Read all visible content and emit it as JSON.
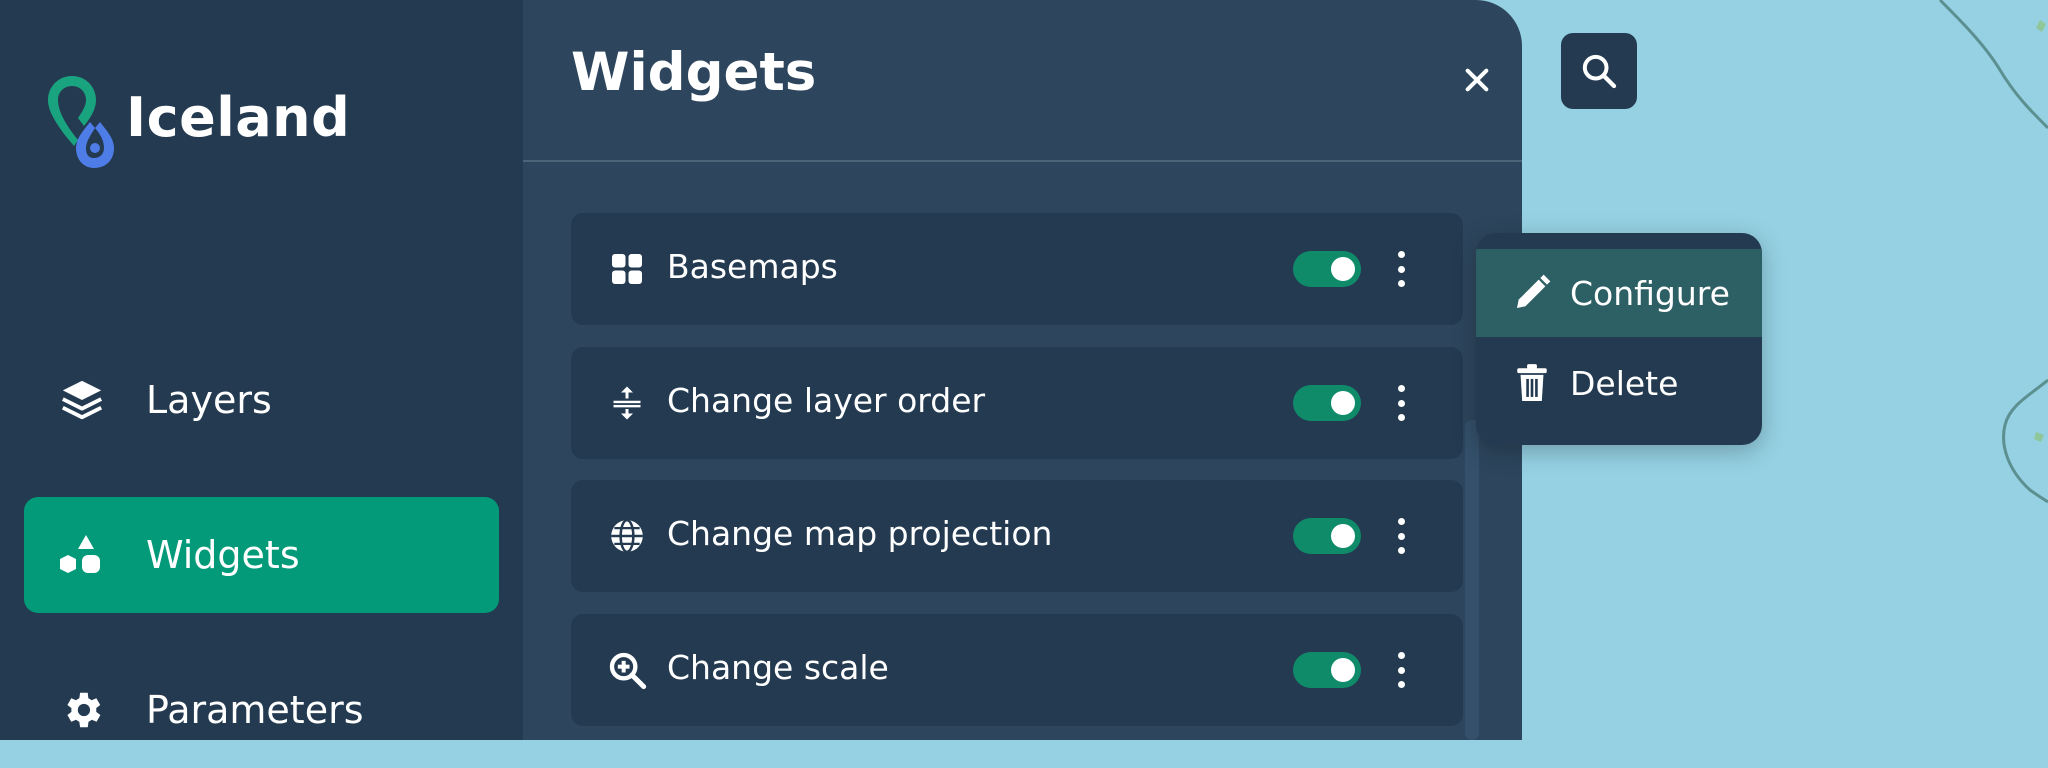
{
  "sidebar": {
    "brand_name": "Iceland",
    "nav": [
      {
        "label": "Layers",
        "icon": "layers-icon"
      },
      {
        "label": "Widgets",
        "icon": "shapes-icon",
        "active": true
      },
      {
        "label": "Parameters",
        "icon": "gear-icon"
      }
    ]
  },
  "panel": {
    "title": "Widgets",
    "close_icon": "close-icon",
    "widgets": [
      {
        "label": "Basemaps",
        "icon": "grid-icon",
        "enabled": true
      },
      {
        "label": "Change layer order",
        "icon": "layer-order-icon",
        "enabled": true
      },
      {
        "label": "Change map projection",
        "icon": "globe-icon",
        "enabled": true
      },
      {
        "label": "Change scale",
        "icon": "zoom-in-icon",
        "enabled": true
      }
    ]
  },
  "map": {
    "search_icon": "search-icon"
  },
  "context_menu": {
    "items": [
      {
        "label": "Configure",
        "icon": "pencil-icon"
      },
      {
        "label": "Delete",
        "icon": "trash-icon"
      }
    ]
  },
  "colors": {
    "sidebar_bg": "#233a51",
    "panel_bg": "#2d465d",
    "accent_green": "#029a78",
    "map_water": "#95d1e3",
    "menu_hover": "#2d6064"
  }
}
